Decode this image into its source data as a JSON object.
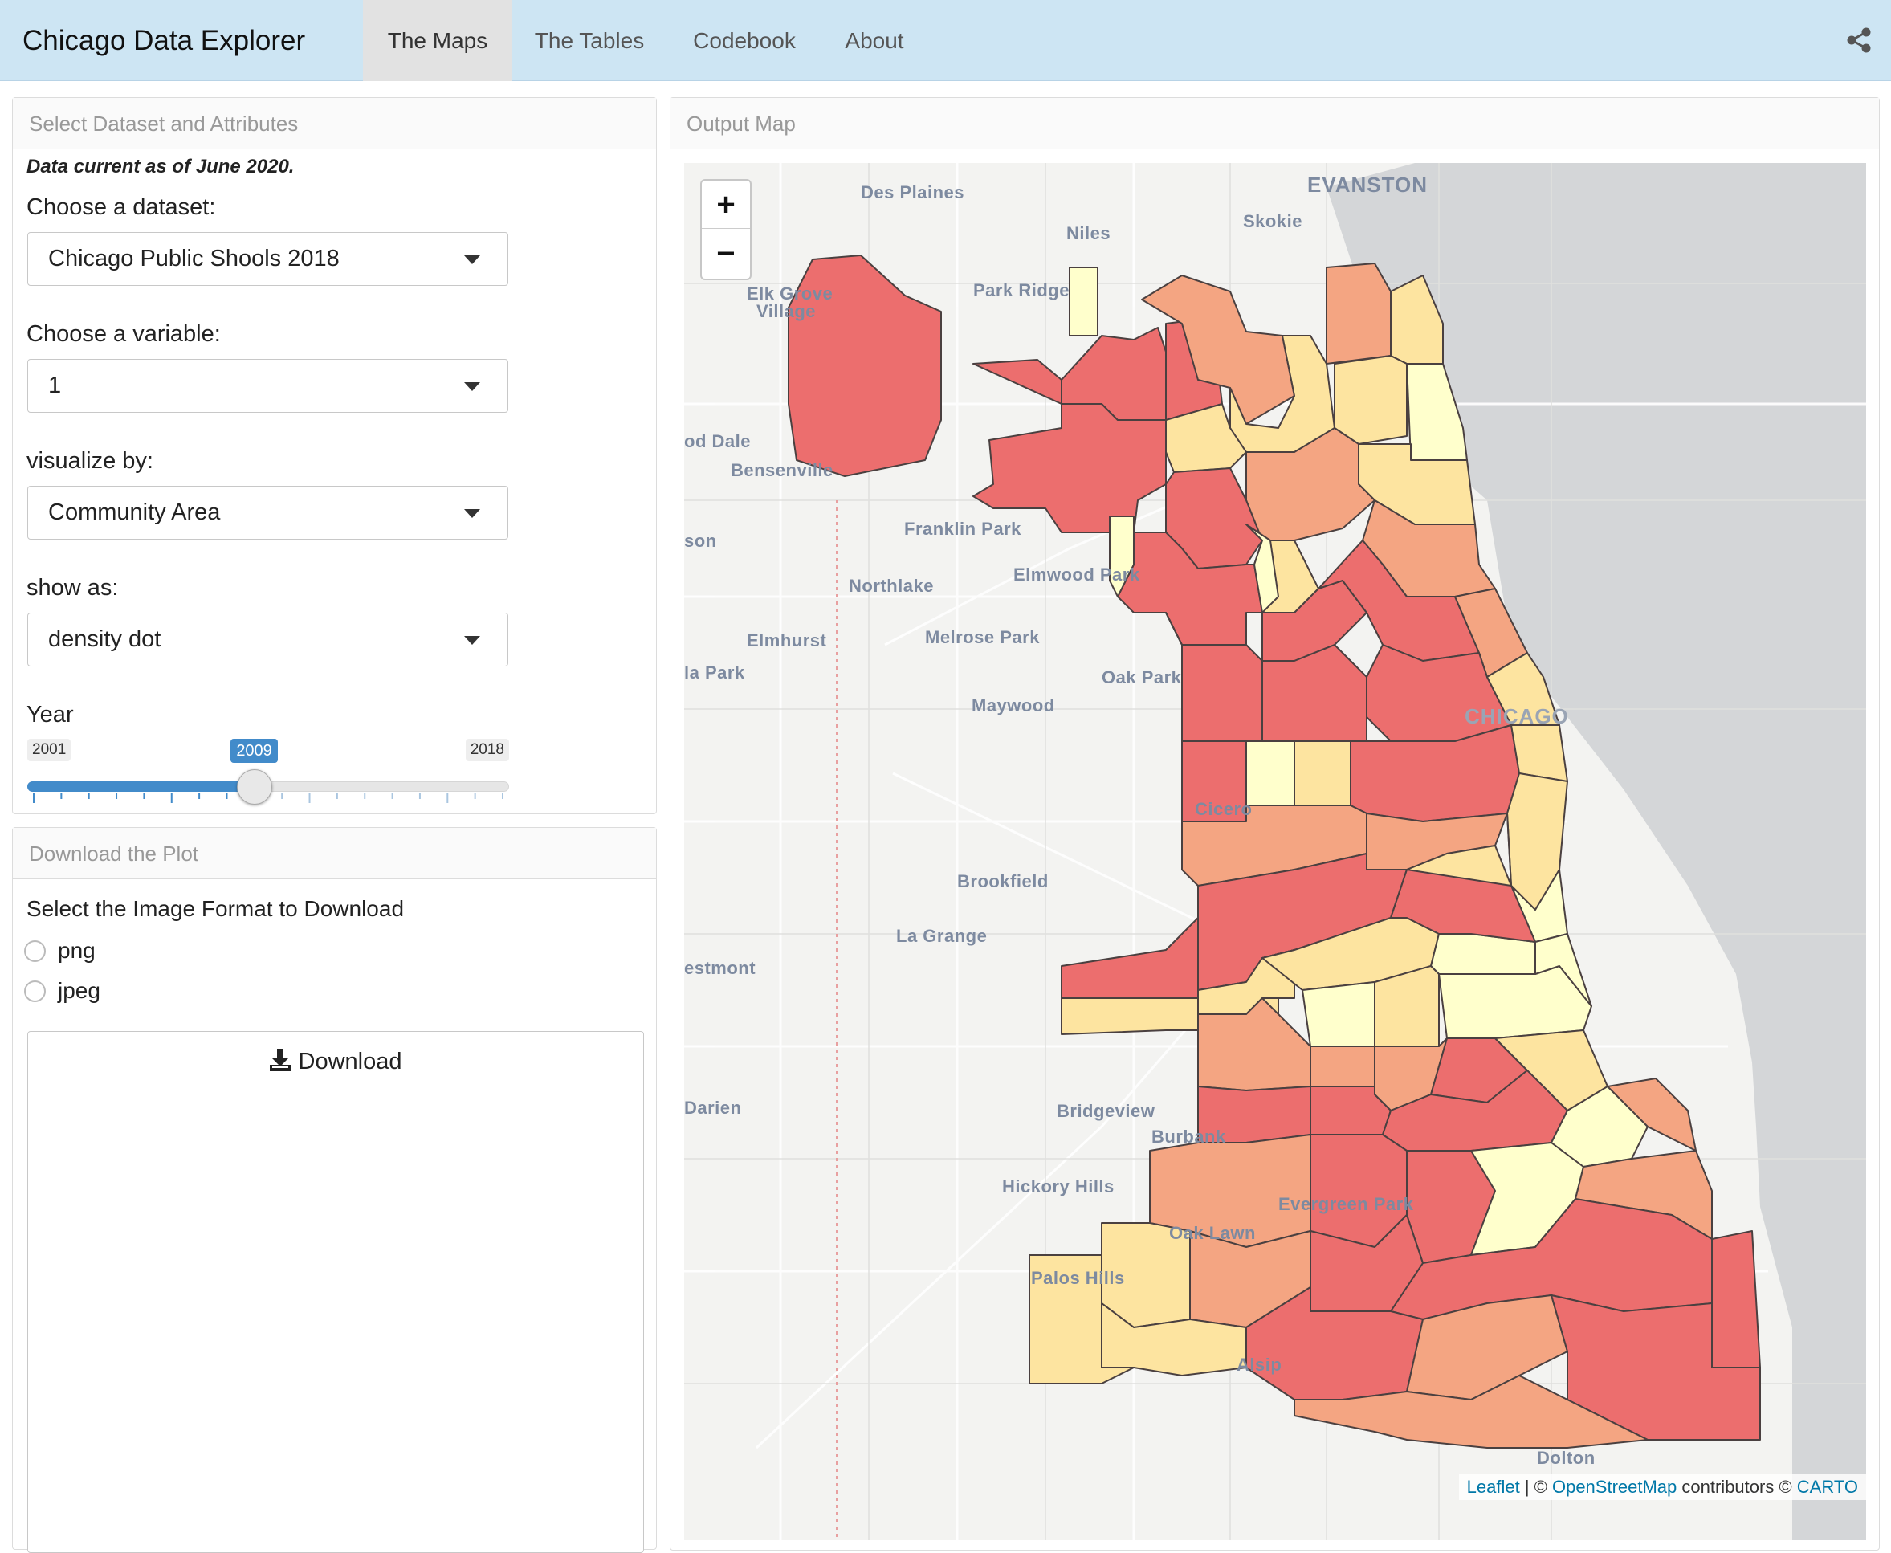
{
  "navbar": {
    "brand": "Chicago Data Explorer",
    "tabs": [
      {
        "label": "The Maps",
        "active": true
      },
      {
        "label": "The Tables",
        "active": false
      },
      {
        "label": "Codebook",
        "active": false
      },
      {
        "label": "About",
        "active": false
      }
    ],
    "share_icon": "share-icon"
  },
  "sidebar": {
    "heading": "Select Dataset and Attributes",
    "note": "Data current as of June 2020.",
    "dataset": {
      "label": "Choose a dataset:",
      "value": "Chicago Public Shools 2018"
    },
    "variable": {
      "label": "Choose a variable:",
      "value": "1"
    },
    "visualize": {
      "label": "visualize by:",
      "value": "Community Area"
    },
    "show_as": {
      "label": "show as:",
      "value": "density dot"
    },
    "year": {
      "label": "Year",
      "min": "2001",
      "max": "2018",
      "value": "2009",
      "fraction": 0.47
    }
  },
  "download": {
    "heading": "Download the Plot",
    "prompt": "Select the Image Format to Download",
    "options": [
      "png",
      "jpeg"
    ],
    "button_label": "Download",
    "button_icon": "download-icon"
  },
  "map": {
    "heading": "Output Map",
    "zoom_in": "+",
    "zoom_out": "−",
    "attribution": {
      "leaflet": "Leaflet",
      "sep": " | © ",
      "osm": "OpenStreetMap",
      "contrib": " contributors © ",
      "carto": "CARTO"
    },
    "colors": {
      "low": "#ffffcc",
      "mid_low": "#fde4a0",
      "mid": "#fdbe85",
      "high": "#f4a582",
      "highest": "#ec6e6e",
      "water": "#d4d6d8",
      "land": "#f3f3f1"
    },
    "places": [
      "EVANSTON",
      "Des Plaines",
      "Skokie",
      "Niles",
      "Elk Grove",
      "Village",
      "Park Ridge",
      "od Dale",
      "Bensenville",
      "Franklin Park",
      "son",
      "Elmwood Park",
      "Northlake",
      "Elmhurst",
      "Melrose Park",
      "la Park",
      "Oak Park",
      "Maywood",
      "CHICAGO",
      "Cicero",
      "Brookfield",
      "La Grange",
      "estmont",
      "Darien",
      "Bridgeview",
      "Burbank",
      "Hickory Hills",
      "Evergreen Park",
      "Oak Lawn",
      "Palos Hills",
      "Alsip",
      "Dolton"
    ]
  }
}
